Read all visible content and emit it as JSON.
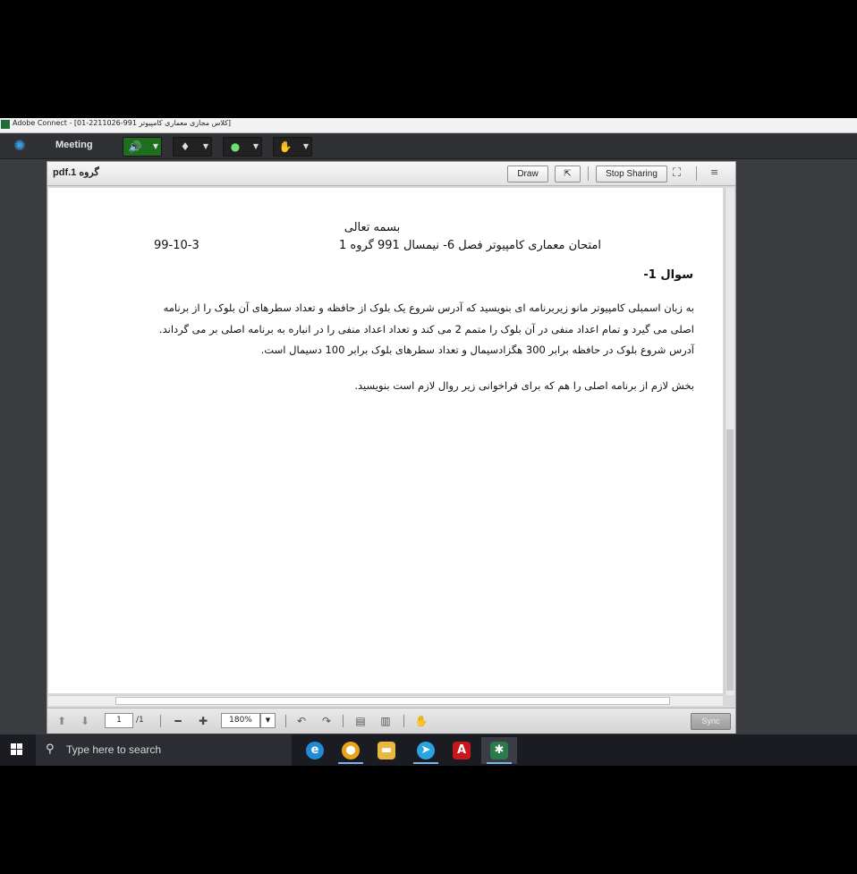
{
  "window": {
    "title": "[کلاس مجازی معماری کامپیوتر 991-2211026-01] - Adobe Connect"
  },
  "menubar": {
    "logo_icon": "adobe-connect-logo",
    "meeting_label": "Meeting",
    "tools": [
      {
        "name": "speaker-icon",
        "glyph": "🔊"
      },
      {
        "name": "microphone-icon",
        "glyph": "🎤"
      },
      {
        "name": "webcam-icon",
        "glyph": "●"
      },
      {
        "name": "raise-hand-icon",
        "glyph": "✋"
      }
    ]
  },
  "pod": {
    "file_name": "گروه 1.pdf",
    "draw_label": "Draw",
    "stop_sharing_label": "Stop Sharing",
    "menu_glyph": "≡"
  },
  "document": {
    "heading": "بسمه تعالی",
    "exam_title": "امتحان معماری کامپیوتر فصل 6- نیمسال  991 گروه 1",
    "date": "99-10-3",
    "question_label": "سوال 1-",
    "paragraph_lines": [
      "به زبان اسمبلی کامپیوتر مانو زیربرنامه ای بنویسید که آدرس شروع یک بلوک از حافظه و تعداد سطرهای آن بلوک را از برنامه",
      "اصلی می گیرد و تمام اعداد منفی در آن بلوک را متمم 2 می کند و تعداد اعداد منفی را در انباره به برنامه اصلی بر می گرداند.",
      "آدرس شروع بلوک در حافظه برابر 300 هگزادسیمال و تعداد سطرهای بلوک برابر 100 دسیمال است."
    ],
    "second_paragraph": "بخش لازم از برنامه اصلی را هم که برای فراخوانی زیر روال لازم است بنویسید."
  },
  "footer": {
    "page_current": "1",
    "page_total": "/1",
    "zoom": "180%",
    "sync_label": "Sync"
  },
  "taskbar": {
    "search_placeholder": "Type here to search",
    "apps": [
      {
        "name": "edge-icon",
        "glyph": "e",
        "color": "#1f8ad6"
      },
      {
        "name": "chrome-icon",
        "glyph": "●",
        "color": "#e8a31c"
      },
      {
        "name": "file-explorer-icon",
        "glyph": "▬",
        "color": "#e8b93c"
      },
      {
        "name": "telegram-icon",
        "glyph": "➤",
        "color": "#2aa3df"
      },
      {
        "name": "acrobat-icon",
        "glyph": "A",
        "color": "#c9171e"
      },
      {
        "name": "adobe-connect-task-icon",
        "glyph": "✱",
        "color": "#2b7a4b"
      }
    ]
  }
}
